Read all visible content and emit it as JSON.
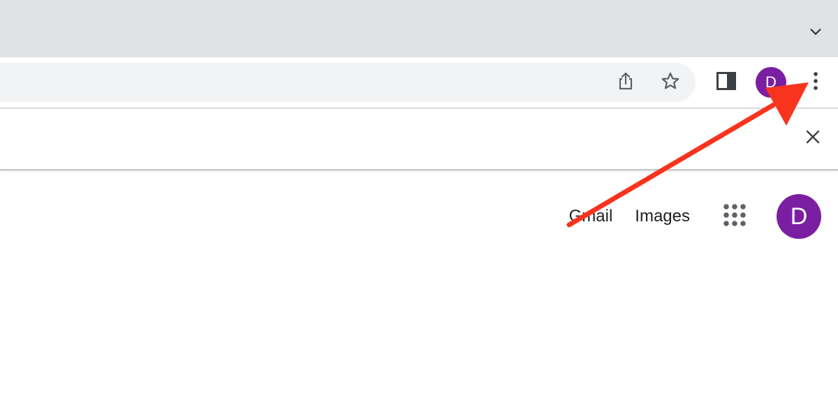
{
  "browser": {
    "tabstrip": {
      "tab_search_icon": "chevron-down-icon"
    },
    "toolbar": {
      "address": {
        "value": "",
        "placeholder": ""
      },
      "share_icon": "share-icon",
      "bookmark_icon": "star-icon",
      "side_panel_icon": "side-panel-icon",
      "profile_initial": "D",
      "menu_icon": "more-vert-icon"
    },
    "infobar": {
      "close_icon": "close-icon"
    }
  },
  "page": {
    "links": {
      "gmail": "Gmail",
      "images": "Images"
    },
    "apps_icon": "apps-grid-icon",
    "account_initial": "D"
  },
  "colors": {
    "tabstrip_bg": "#dfe1e5",
    "omnibox_bg": "#f1f3f4",
    "avatar_purple": "#7b1fa2",
    "annotation_arrow": "#f8341f",
    "icon_gray": "#5f6368"
  }
}
